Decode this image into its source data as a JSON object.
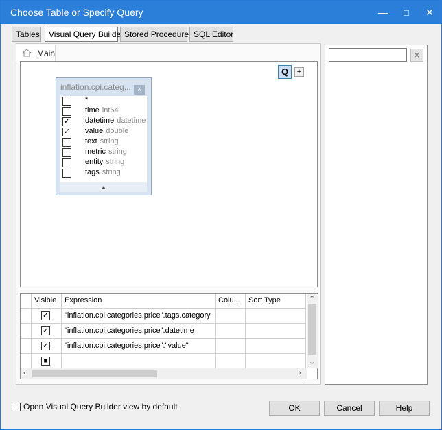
{
  "window": {
    "title": "Choose Table or Specify Query"
  },
  "titlebar_buttons": {
    "minimize": "—",
    "maximize": "□",
    "close": "✕"
  },
  "tabs": [
    {
      "label": "Tables",
      "active": false
    },
    {
      "label": "Visual Query Builder",
      "active": true
    },
    {
      "label": "Stored Procedures",
      "active": false
    },
    {
      "label": "SQL Editor",
      "active": false
    }
  ],
  "main_tab": {
    "label": "Main"
  },
  "canvas_buttons": {
    "query": "Q",
    "add": "+"
  },
  "table_box": {
    "title": "inflation.cpi.categ...",
    "close": "×",
    "fields": [
      {
        "name": "*",
        "type": "",
        "checked": false
      },
      {
        "name": "time",
        "type": "int64",
        "checked": false
      },
      {
        "name": "datetime",
        "type": "datetime",
        "checked": true
      },
      {
        "name": "value",
        "type": "double",
        "checked": true
      },
      {
        "name": "text",
        "type": "string",
        "checked": false
      },
      {
        "name": "metric",
        "type": "string",
        "checked": false
      },
      {
        "name": "entity",
        "type": "string",
        "checked": false
      },
      {
        "name": "tags",
        "type": "string",
        "checked": false
      }
    ],
    "collapse_glyph": "▲"
  },
  "grid": {
    "headers": {
      "visible": "Visible",
      "expression": "Expression",
      "column": "Colu...",
      "sort_type": "Sort Type"
    },
    "rows": [
      {
        "visible": true,
        "expression": "\"inflation.cpi.categories.price\".tags.category"
      },
      {
        "visible": true,
        "expression": "\"inflation.cpi.categories.price\".datetime"
      },
      {
        "visible": true,
        "expression": "\"inflation.cpi.categories.price\".\"value\""
      }
    ],
    "new_row_marker": "■"
  },
  "search": {
    "value": "",
    "clear": "✕"
  },
  "footer": {
    "open_default_label": "Open Visual Query Builder view by default",
    "ok": "OK",
    "cancel": "Cancel",
    "help": "Help"
  }
}
